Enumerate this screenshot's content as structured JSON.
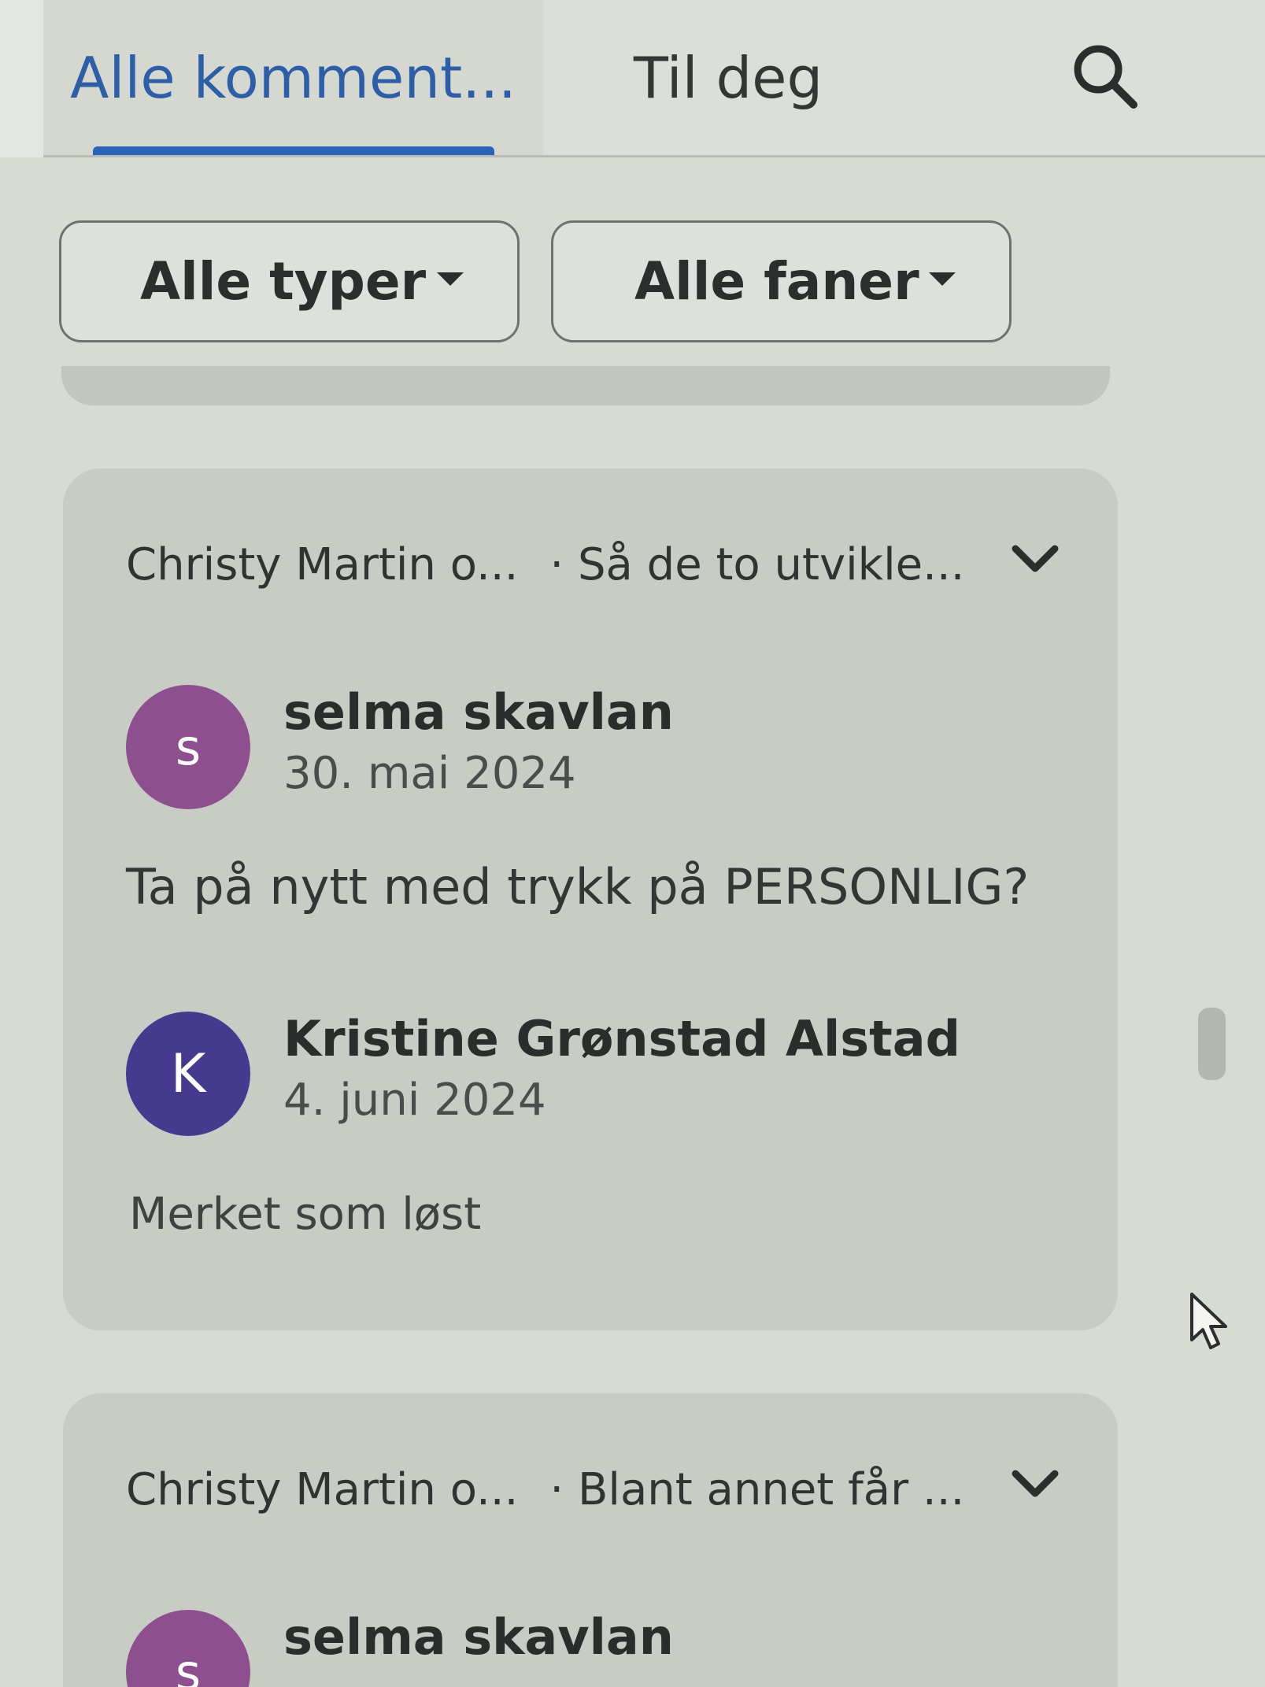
{
  "tabs": {
    "all_comments": "Alle komment...",
    "for_you": "Til deg"
  },
  "filters": {
    "type_label": "Alle typer",
    "tab_label": "Alle faner"
  },
  "threads": [
    {
      "participants": "Christy Martin o...",
      "snippet": "· Så de to utvikle...",
      "comments": [
        {
          "avatar_letter": "s",
          "author": "selma skavlan",
          "date": "30. mai 2024",
          "text": "Ta på nytt med trykk på PERSONLIG?"
        },
        {
          "avatar_letter": "K",
          "author": "Kristine Grønstad Alstad",
          "date": "4. juni 2024",
          "text": "Merket som løst"
        }
      ]
    },
    {
      "participants": "Christy Martin o...",
      "snippet": "· Blant annet får ...",
      "comments": [
        {
          "avatar_letter": "s",
          "author": "selma skavlan"
        }
      ]
    }
  ],
  "colors": {
    "accent": "#2a63b8",
    "avatar_selma": "#8e4f8e",
    "avatar_kristine": "#463a8e",
    "background": "#d7dbd4",
    "card": "#c8ccc5"
  },
  "icons": [
    "search-icon",
    "chevron-down-icon",
    "dropdown-caret-icon",
    "mouse-cursor-icon"
  ]
}
